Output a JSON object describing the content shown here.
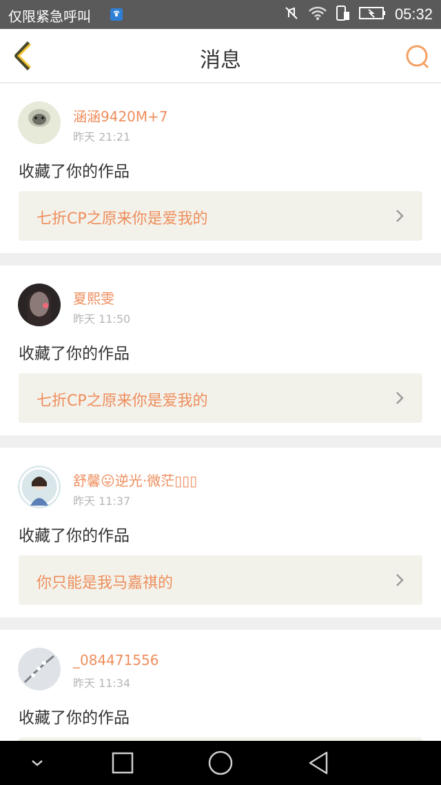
{
  "status_bar": {
    "carrier": "仅限紧急呼叫",
    "time": "05:32",
    "icons": [
      "hotspot-icon",
      "mute-icon",
      "wifi-icon",
      "sim-icon",
      "battery-charging-icon"
    ]
  },
  "header": {
    "title": "消息",
    "back_icon": "back-chevron-icon",
    "search_icon": "search-icon"
  },
  "accent_color": "#ee8d5c",
  "messages": [
    {
      "username": "涵涵9420M+7",
      "time": "昨天 21:21",
      "action": "收藏了你的作品",
      "work_title": "七折CP之原来你是爱我的"
    },
    {
      "username": "夏熙雯",
      "time": "昨天 11:50",
      "action": "收藏了你的作品",
      "work_title": "七折CP之原来你是爱我的"
    },
    {
      "username": "舒馨😛逆光·微茫▯▯▯",
      "time": "昨天 11:37",
      "action": "收藏了你的作品",
      "work_title": "你只能是我马嘉祺的"
    },
    {
      "username": "_084471556",
      "time": "昨天 11:34",
      "action": "收藏了你的作品",
      "work_title": ""
    }
  ],
  "nav_bar": {
    "icons": [
      "hide-nav-icon",
      "recent-apps-icon",
      "home-icon",
      "back-triangle-icon"
    ]
  }
}
